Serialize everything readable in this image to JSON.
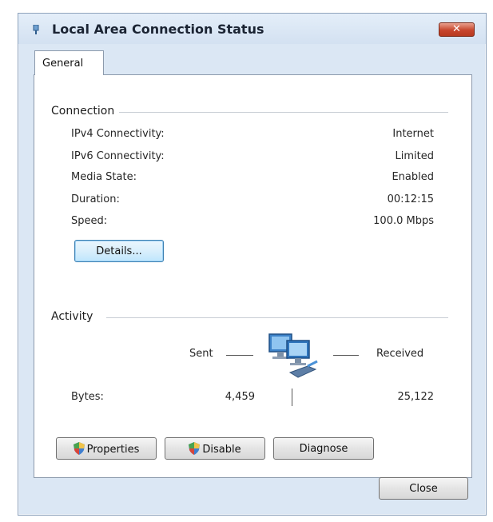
{
  "window": {
    "title": "Local Area Connection Status",
    "close_label": "✕"
  },
  "tabs": [
    {
      "label": "General",
      "selected": true
    }
  ],
  "connection": {
    "group_label": "Connection",
    "rows": [
      {
        "label": "IPv4 Connectivity:",
        "value": "Internet"
      },
      {
        "label": "IPv6 Connectivity:",
        "value": "Limited"
      },
      {
        "label": "Media State:",
        "value": "Enabled"
      },
      {
        "label": "Duration:",
        "value": "00:12:15"
      },
      {
        "label": "Speed:",
        "value": "100.0 Mbps"
      }
    ],
    "details_button": "Details..."
  },
  "activity": {
    "group_label": "Activity",
    "sent_label": "Sent",
    "received_label": "Received",
    "bytes_label": "Bytes:",
    "bytes_sent": "4,459",
    "bytes_received": "25,122"
  },
  "buttons": {
    "properties": "Properties",
    "disable": "Disable",
    "diagnose": "Diagnose",
    "close": "Close"
  },
  "icons": {
    "title": "network-adapter-icon",
    "activity": "network-computers-icon",
    "uac_shield": "uac-shield-icon"
  },
  "colors": {
    "window_frame": "#dbe7f4",
    "close_button": "#c7462d",
    "focus_border": "#3c7fb1"
  }
}
